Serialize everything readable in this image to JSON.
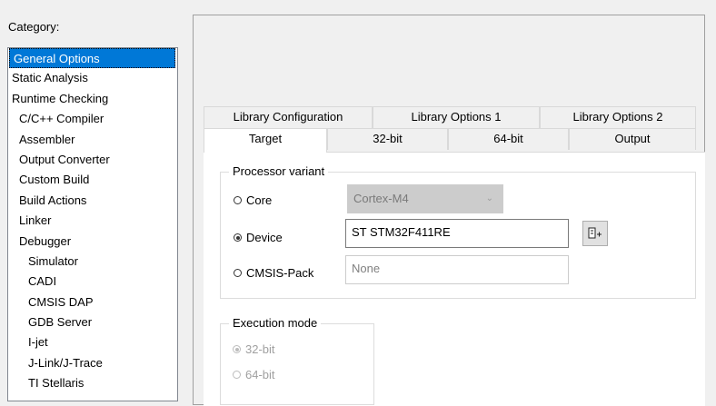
{
  "category": {
    "label": "Category:",
    "items": [
      {
        "label": "General Options",
        "selected": true
      },
      {
        "label": "Static Analysis"
      },
      {
        "label": "Runtime Checking"
      },
      {
        "label": "C/C++ Compiler"
      },
      {
        "label": "Assembler"
      },
      {
        "label": "Output Converter"
      },
      {
        "label": "Custom Build"
      },
      {
        "label": "Build Actions"
      },
      {
        "label": "Linker"
      },
      {
        "label": "Debugger"
      },
      {
        "label": "Simulator"
      },
      {
        "label": "CADI"
      },
      {
        "label": "CMSIS DAP"
      },
      {
        "label": "GDB Server"
      },
      {
        "label": "I-jet"
      },
      {
        "label": "J-Link/J-Trace"
      },
      {
        "label": "TI Stellaris"
      }
    ]
  },
  "tabs": {
    "back_row": [
      "Library Configuration",
      "Library Options 1",
      "Library Options 2"
    ],
    "front_row": [
      "Target",
      "32-bit",
      "64-bit",
      "Output"
    ],
    "active": "Target"
  },
  "processor_variant": {
    "title": "Processor variant",
    "core_label": "Core",
    "core_value": "Cortex-M4",
    "device_label": "Device",
    "device_value": "ST STM32F411RE",
    "cmsis_label": "CMSIS-Pack",
    "cmsis_value": "None",
    "selected": "Device"
  },
  "execution_mode": {
    "title": "Execution mode",
    "option_32": "32-bit",
    "option_64": "64-bit",
    "selected": "32-bit"
  },
  "colors": {
    "selection": "#0078d7",
    "disabled_combo": "#cccccc"
  },
  "icons": {
    "browse": "device-select-icon",
    "combo_arrow": "chevron-down-icon"
  }
}
